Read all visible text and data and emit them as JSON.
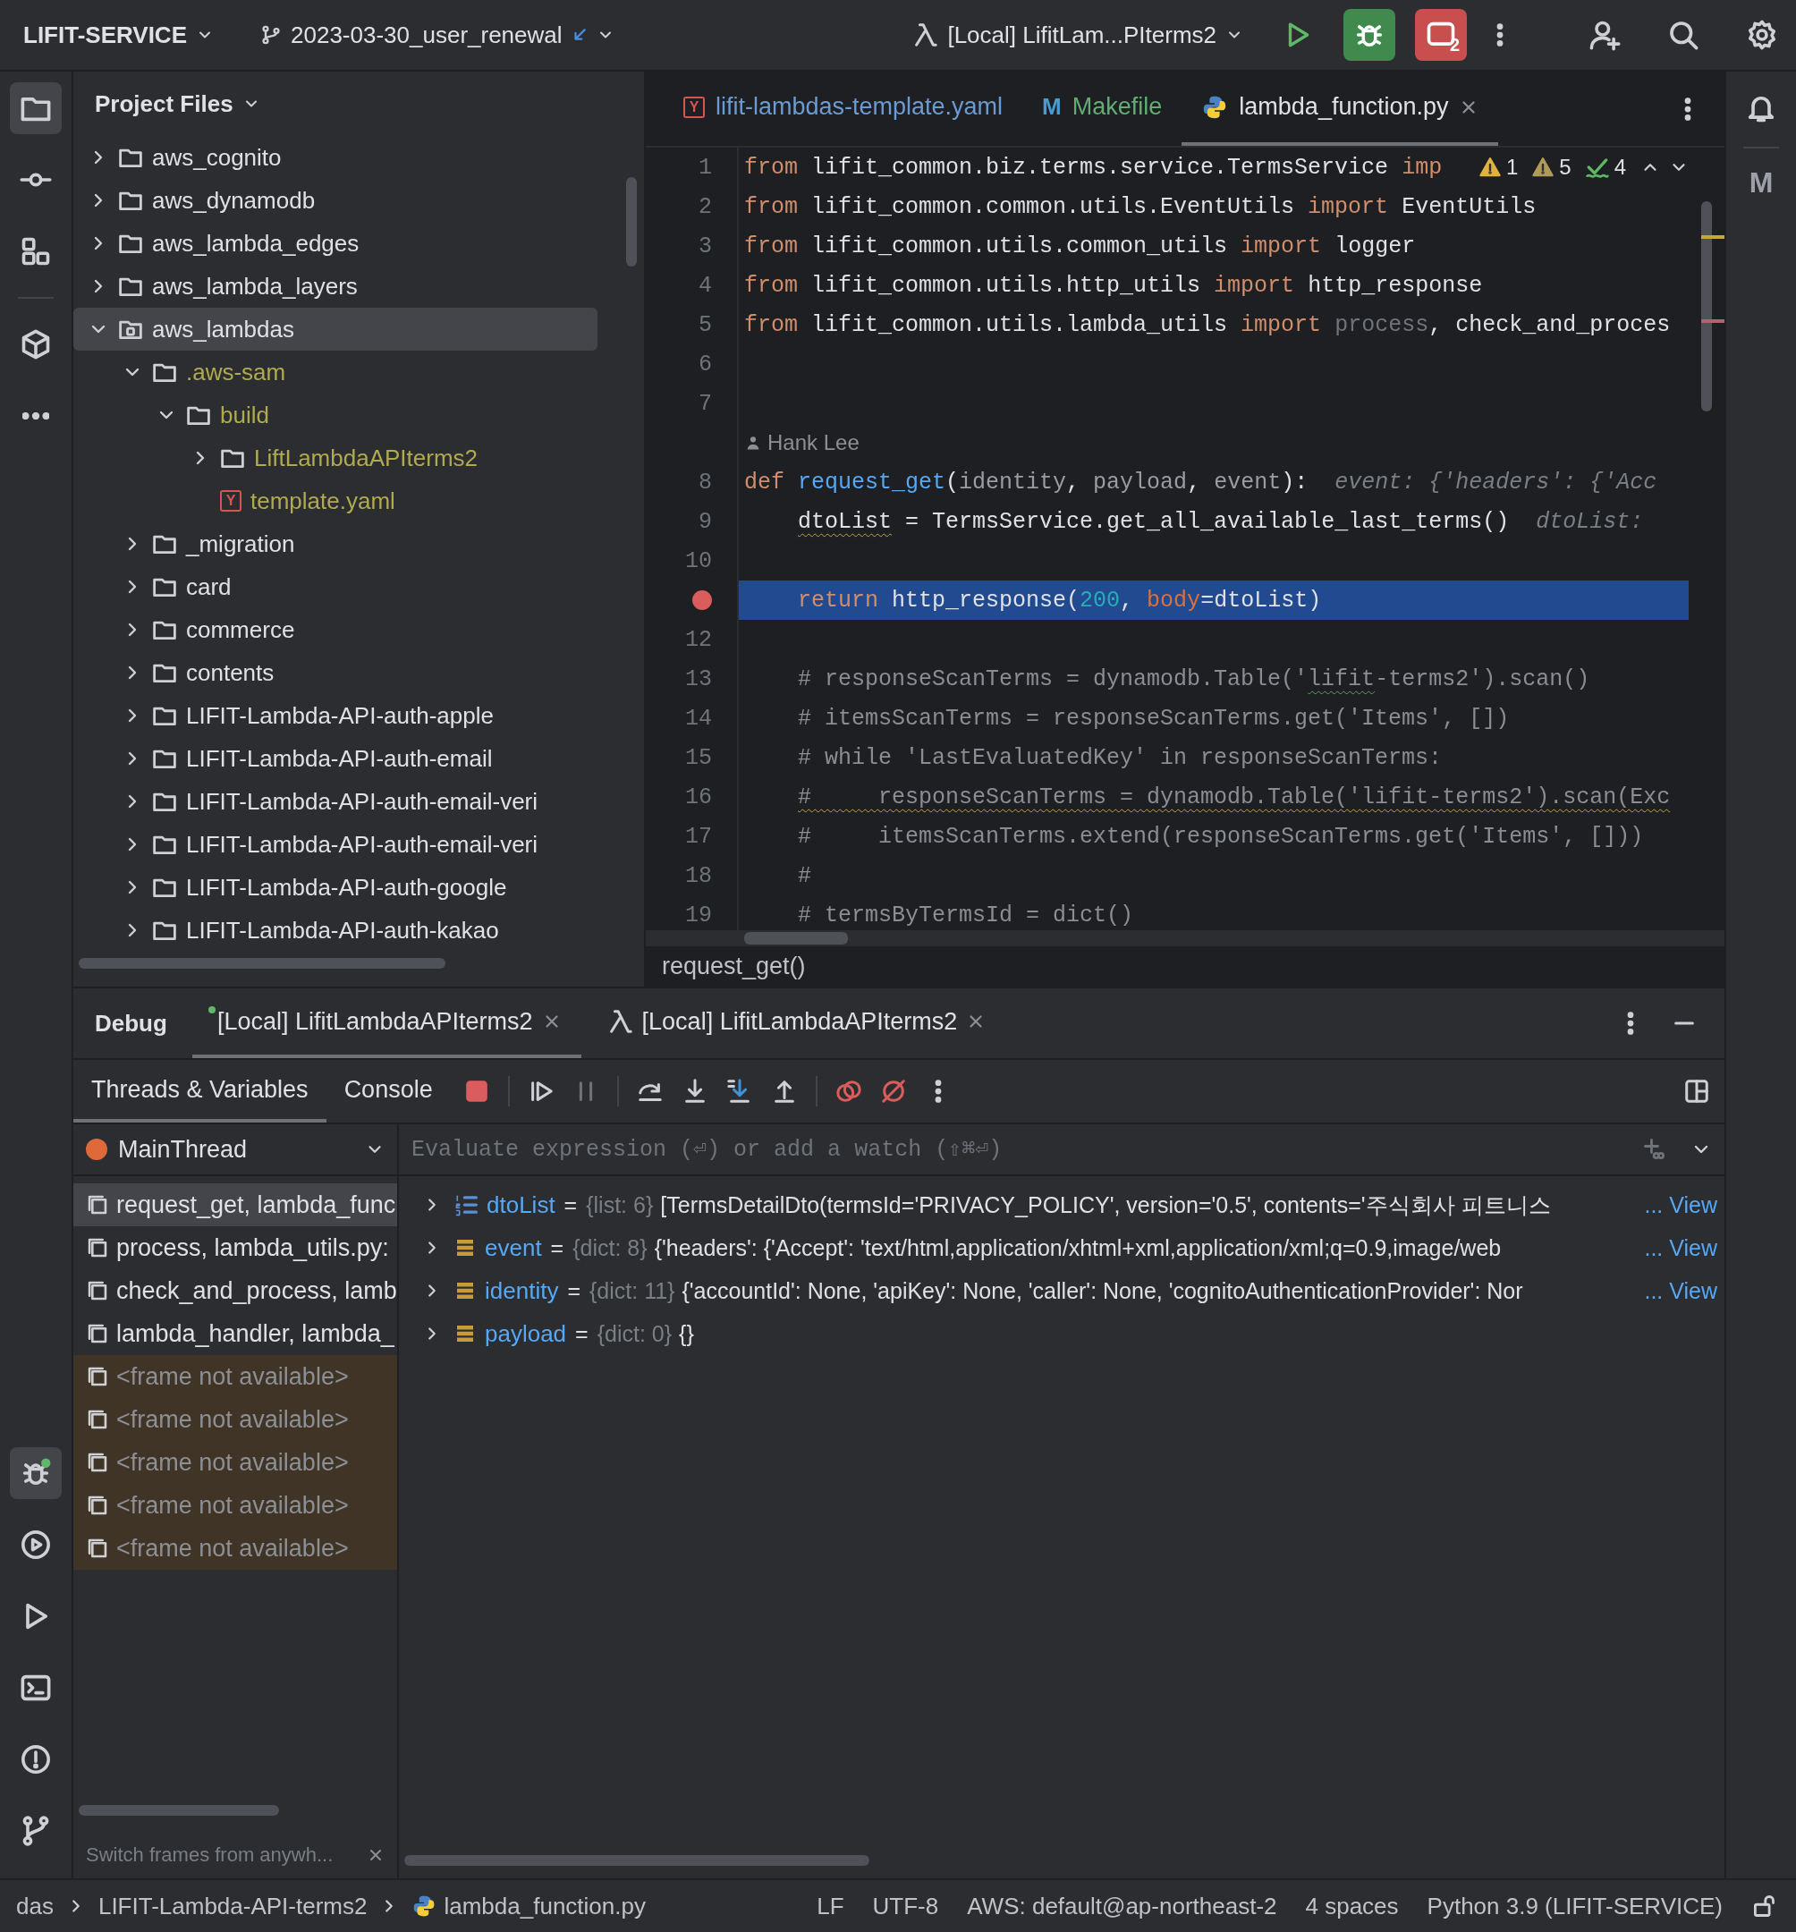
{
  "topbar": {
    "project": "LIFIT-SERVICE",
    "branch": "2023-03-30_user_renewal",
    "run_config": "[Local] LifitLam...PIterms2",
    "stop_count": "2"
  },
  "project_panel": {
    "title": "Project Files",
    "tree": [
      {
        "label": "aws_cognito",
        "kind": "folder",
        "expanded": false,
        "selected": false
      },
      {
        "label": "aws_dynamodb",
        "kind": "folder",
        "expanded": false,
        "selected": false
      },
      {
        "label": "aws_lambda_edges",
        "kind": "folder",
        "expanded": false,
        "selected": false
      },
      {
        "label": "aws_lambda_layers",
        "kind": "folder",
        "expanded": false,
        "selected": false
      },
      {
        "label": "aws_lambdas",
        "kind": "module",
        "expanded": true,
        "selected": true,
        "children": [
          {
            "label": ".aws-sam",
            "kind": "folder",
            "expanded": true,
            "selected": false,
            "ignored": true,
            "children": [
              {
                "label": "build",
                "kind": "folder",
                "expanded": true,
                "selected": false,
                "ignored": true,
                "children": [
                  {
                    "label": "LiftLambdaAPIterms2",
                    "kind": "folder",
                    "expanded": false,
                    "selected": false,
                    "ignored": true
                  },
                  {
                    "label": "template.yaml",
                    "kind": "yaml",
                    "icon_text": "Y",
                    "selected": false,
                    "ignored": true
                  }
                ]
              }
            ]
          },
          {
            "label": "_migration",
            "kind": "folder",
            "expanded": false,
            "selected": false
          },
          {
            "label": "card",
            "kind": "folder",
            "expanded": false,
            "selected": false
          },
          {
            "label": "commerce",
            "kind": "folder",
            "expanded": false,
            "selected": false
          },
          {
            "label": "contents",
            "kind": "folder",
            "expanded": false,
            "selected": false
          },
          {
            "label": "LIFIT-Lambda-API-auth-apple",
            "kind": "folder",
            "expanded": false,
            "selected": false
          },
          {
            "label": "LIFIT-Lambda-API-auth-email",
            "kind": "folder",
            "expanded": false,
            "selected": false
          },
          {
            "label": "LIFIT-Lambda-API-auth-email-veri",
            "kind": "folder",
            "expanded": false,
            "selected": false
          },
          {
            "label": "LIFIT-Lambda-API-auth-email-veri",
            "kind": "folder",
            "expanded": false,
            "selected": false
          },
          {
            "label": "LIFIT-Lambda-API-auth-google",
            "kind": "folder",
            "expanded": false,
            "selected": false
          },
          {
            "label": "LIFIT-Lambda-API-auth-kakao",
            "kind": "folder",
            "expanded": false,
            "selected": false
          }
        ]
      }
    ]
  },
  "editor": {
    "tabs": [
      {
        "label": "lifit-lambdas-template.yaml",
        "kind": "yaml",
        "icon_text": "Y",
        "color": "#6b9bd2",
        "selected": false
      },
      {
        "label": "Makefile",
        "kind": "makefile",
        "icon_text": "M",
        "color": "#62ad74",
        "selected": false
      },
      {
        "label": "lambda_function.py",
        "kind": "python",
        "selected": true
      }
    ],
    "inspections": [
      {
        "kind": "warning",
        "count": "1"
      },
      {
        "kind": "weak_warning",
        "count": "5"
      },
      {
        "kind": "typo",
        "count": "4"
      }
    ],
    "lines": [
      {
        "number": "1",
        "tokens": [
          {
            "t": "from ",
            "kind": "keyword"
          },
          {
            "t": "lifit_common.biz.terms.service.TermsService ",
            "kind": "plain"
          },
          {
            "t": "imp",
            "kind": "keyword"
          }
        ]
      },
      {
        "number": "2",
        "tokens": [
          {
            "t": "from ",
            "kind": "keyword"
          },
          {
            "t": "lifit_common.common.utils.EventUtils ",
            "kind": "plain"
          },
          {
            "t": "import ",
            "kind": "keyword"
          },
          {
            "t": "EventUtils",
            "kind": "plain"
          }
        ]
      },
      {
        "number": "3",
        "tokens": [
          {
            "t": "from ",
            "kind": "keyword"
          },
          {
            "t": "lifit_common.utils.common_utils ",
            "kind": "plain"
          },
          {
            "t": "import ",
            "kind": "keyword"
          },
          {
            "t": "logger",
            "kind": "plain"
          }
        ]
      },
      {
        "number": "4",
        "tokens": [
          {
            "t": "from ",
            "kind": "keyword"
          },
          {
            "t": "lifit_common.utils.http_utils ",
            "kind": "plain"
          },
          {
            "t": "import ",
            "kind": "keyword"
          },
          {
            "t": "http_response",
            "kind": "plain"
          }
        ]
      },
      {
        "number": "5",
        "tokens": [
          {
            "t": "from ",
            "kind": "keyword"
          },
          {
            "t": "lifit_common.utils.lambda_utils ",
            "kind": "plain"
          },
          {
            "t": "import ",
            "kind": "keyword"
          },
          {
            "t": "process",
            "kind": "unused"
          },
          {
            "t": ", check_and_proces",
            "kind": "plain"
          }
        ]
      },
      {
        "number": "6"
      },
      {
        "number": "7"
      },
      {
        "kind": "author",
        "text": "Hank Lee"
      },
      {
        "number": "8",
        "tokens": [
          {
            "t": "def ",
            "kind": "keyword"
          },
          {
            "t": "request_get",
            "kind": "function"
          },
          {
            "t": "(",
            "kind": "plain"
          },
          {
            "t": "identity",
            "kind": "parameter"
          },
          {
            "t": ", ",
            "kind": "plain"
          },
          {
            "t": "payload",
            "kind": "parameter"
          },
          {
            "t": ", ",
            "kind": "plain"
          },
          {
            "t": "event",
            "kind": "parameter"
          },
          {
            "t": "):",
            "kind": "plain"
          },
          {
            "t": "event: {'headers': {'Acc",
            "kind": "hint"
          }
        ]
      },
      {
        "number": "9",
        "tokens": [
          {
            "t": "    dtoList",
            "kind": "plain",
            "warning_underline": true
          },
          {
            "t": " = TermsService.get_all_available_last_terms()",
            "kind": "plain"
          },
          {
            "t": "dtoList:",
            "kind": "hint"
          }
        ]
      },
      {
        "number": "10"
      },
      {
        "breakpoint": true,
        "current": true,
        "tokens": [
          {
            "t": "    return ",
            "kind": "keyword"
          },
          {
            "t": "http_response(",
            "kind": "plain"
          },
          {
            "t": "200",
            "kind": "number"
          },
          {
            "t": ", ",
            "kind": "plain"
          },
          {
            "t": "body",
            "kind": "named_arg"
          },
          {
            "t": "=dtoList)",
            "kind": "plain"
          }
        ]
      },
      {
        "number": "12"
      },
      {
        "number": "13",
        "tokens": [
          {
            "t": "    # responseScanTerms = dynamodb.Table('",
            "kind": "comment"
          },
          {
            "t": "lifit",
            "kind": "comment",
            "typo_underline": true
          },
          {
            "t": "-terms2').scan()",
            "kind": "comment"
          }
        ]
      },
      {
        "number": "14",
        "tokens": [
          {
            "t": "    # itemsScanTerms = responseScanTerms.get('Items', [])",
            "kind": "comment"
          }
        ]
      },
      {
        "number": "15",
        "tokens": [
          {
            "t": "    # while 'LastEvaluatedKey' in responseScanTerms:",
            "kind": "comment"
          }
        ]
      },
      {
        "number": "16",
        "tokens": [
          {
            "t": "    #     responseScanTerms = dynamodb.Table('lifit-terms2').scan(Exc",
            "kind": "comment",
            "warning_underline": true
          }
        ]
      },
      {
        "number": "17",
        "tokens": [
          {
            "t": "    #     itemsScanTerms.extend(responseScanTerms.get('Items', []))",
            "kind": "comment"
          }
        ]
      },
      {
        "number": "18",
        "tokens": [
          {
            "t": "    #",
            "kind": "comment"
          }
        ]
      },
      {
        "number": "19",
        "tokens": [
          {
            "t": "    # termsByTermsId = dict()",
            "kind": "comment"
          }
        ]
      }
    ],
    "breadcrumb": "request_get()"
  },
  "debug": {
    "title": "Debug",
    "sessions": [
      {
        "label": "[Local] LifitLambdaAPIterms2",
        "kind": "process",
        "running": true,
        "selected": true
      },
      {
        "label": "[Local] LifitLambdaAPIterms2",
        "kind": "sam",
        "running": false,
        "selected": false
      }
    ],
    "subtabs": [
      {
        "label": "Threads & Variables",
        "selected": true
      },
      {
        "label": "Console",
        "selected": false
      }
    ],
    "thread": {
      "name": "MainThread",
      "paused": true
    },
    "frames": [
      {
        "label": "request_get, lambda_func",
        "available": true,
        "selected": true
      },
      {
        "label": "process, lambda_utils.py:",
        "available": true,
        "selected": false
      },
      {
        "label": "check_and_process, lamb",
        "available": true,
        "selected": false
      },
      {
        "label": "lambda_handler, lambda_",
        "available": true,
        "selected": false
      },
      {
        "label": "<frame not available>",
        "available": false,
        "selected": false
      },
      {
        "label": "<frame not available>",
        "available": false,
        "selected": false
      },
      {
        "label": "<frame not available>",
        "available": false,
        "selected": false
      },
      {
        "label": "<frame not available>",
        "available": false,
        "selected": false
      },
      {
        "label": "<frame not available>",
        "available": false,
        "selected": false
      }
    ],
    "frames_hint": "Switch frames from anywh...",
    "evaluate": {
      "placeholder": "Evaluate expression (⏎) or add a watch (⇧⌘⏎)"
    },
    "variables": [
      {
        "name": "dtoList",
        "kind": "list",
        "eq": "=",
        "type": "{list: 6}",
        "value": "[TermsDetailDto(termsId='PRIVACY_POLICY', version='0.5', contents='주식회사 피트니스",
        "link": "... View"
      },
      {
        "name": "event",
        "kind": "dict",
        "eq": "=",
        "type": "{dict: 8}",
        "value": "{'headers': {'Accept': 'text/html,application/xhtml+xml,application/xml;q=0.9,image/web",
        "link": "... View"
      },
      {
        "name": "identity",
        "kind": "dict",
        "eq": "=",
        "type": "{dict: 11}",
        "value": "{'accountId': None, 'apiKey': None, 'caller': None, 'cognitoAuthenticationProvider': Nor",
        "link": "... View"
      },
      {
        "name": "payload",
        "kind": "dict",
        "eq": "=",
        "type": "{dict: 0}",
        "value": "{}"
      }
    ]
  },
  "right_strip": {
    "plugin_letter": "M"
  },
  "status_bar": {
    "crumbs": [
      {
        "label": "das",
        "kind": "folder"
      },
      {
        "label": "LIFIT-Lambda-API-terms2",
        "kind": "folder"
      },
      {
        "label": "lambda_function.py",
        "kind": "python"
      }
    ],
    "items": [
      "LF",
      "UTF-8",
      "AWS: default@ap-northeast-2",
      "4 spaces",
      "Python 3.9 (LIFIT-SERVICE)"
    ]
  }
}
